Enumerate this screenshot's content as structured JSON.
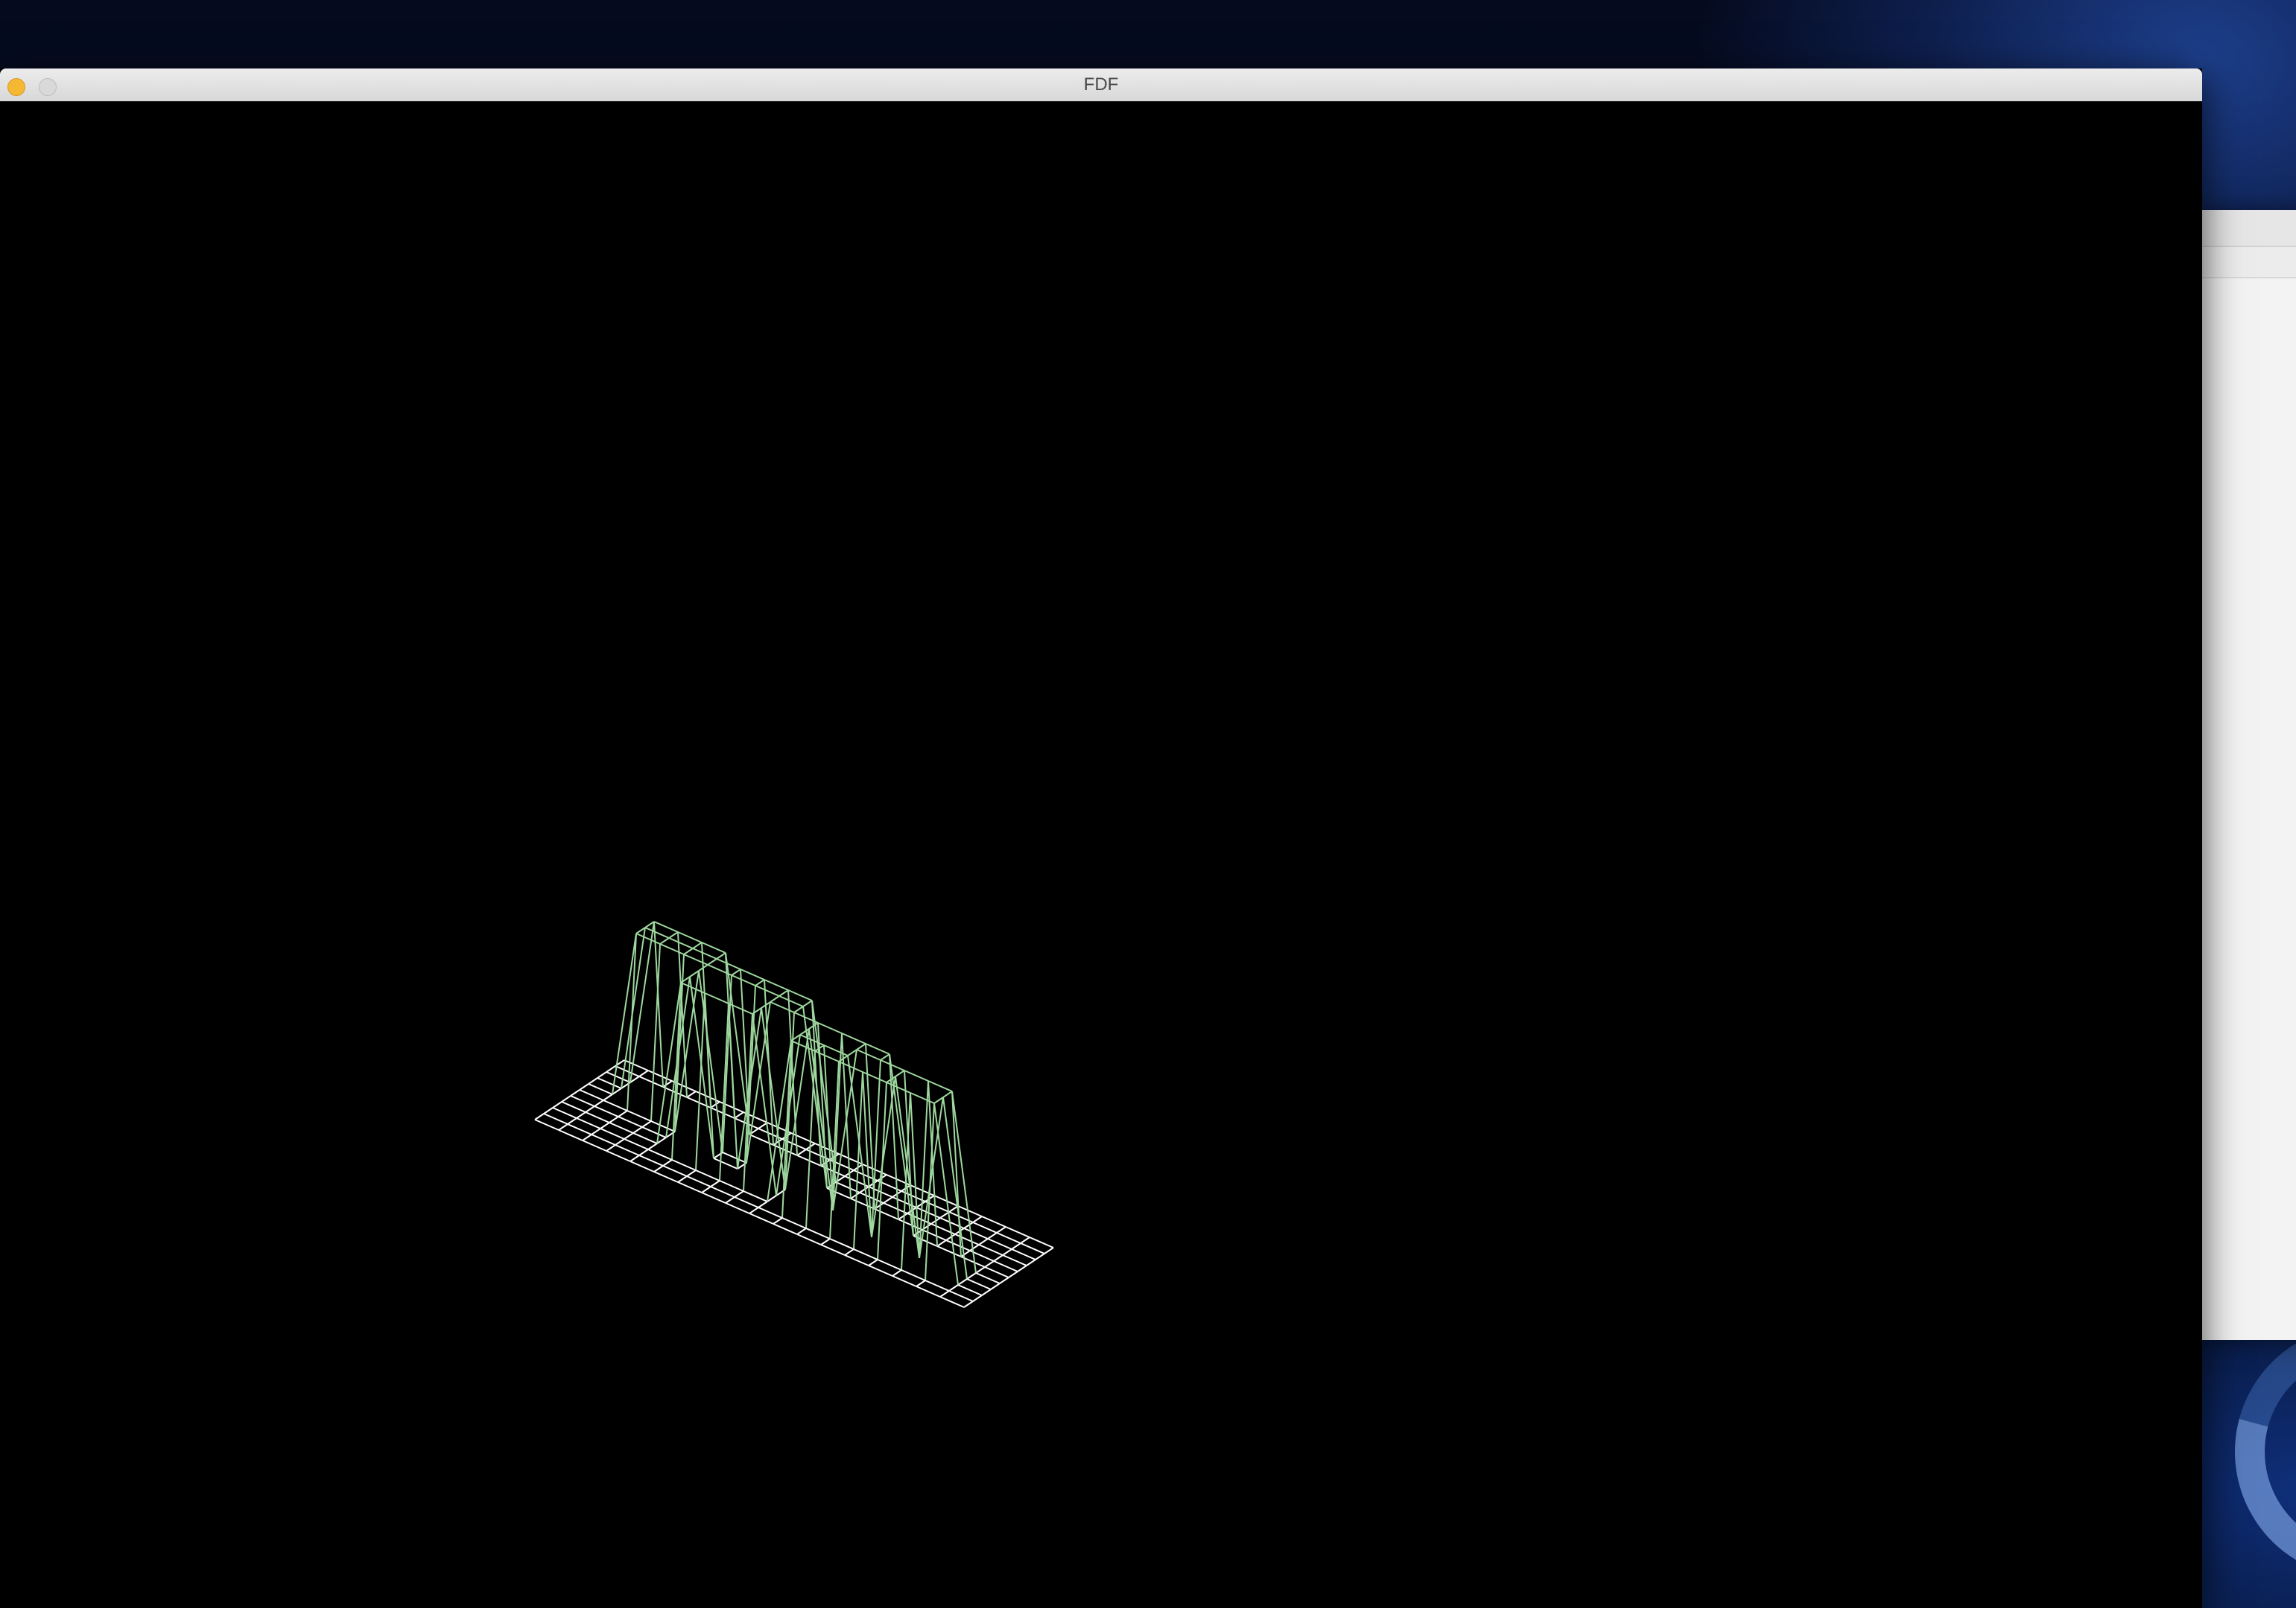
{
  "window": {
    "title": "FDF"
  },
  "colors": {
    "low_line": "#ffffff",
    "high_line": "#9fd89f",
    "canvas_bg": "#000000",
    "titlebar": "#e0e0e0",
    "close_button": "#f5b833"
  },
  "icons": {
    "close": "close-icon",
    "minimize": "minimize-icon"
  },
  "heightmap": [
    [
      0,
      0,
      0,
      0,
      0,
      0,
      0,
      0,
      0,
      0,
      0,
      0,
      0,
      0,
      0,
      0,
      0,
      0,
      0
    ],
    [
      0,
      0,
      0,
      0,
      0,
      0,
      0,
      0,
      0,
      0,
      0,
      0,
      0,
      0,
      0,
      0,
      0,
      0,
      0
    ],
    [
      0,
      0,
      10,
      10,
      10,
      10,
      0,
      0,
      0,
      0,
      0,
      0,
      0,
      0,
      0,
      0,
      0,
      0,
      0
    ],
    [
      0,
      0,
      10,
      10,
      10,
      10,
      10,
      10,
      10,
      10,
      0,
      0,
      0,
      0,
      0,
      0,
      0,
      0,
      0
    ],
    [
      0,
      0,
      10,
      10,
      10,
      10,
      10,
      10,
      10,
      10,
      0,
      0,
      0,
      0,
      0,
      0,
      0,
      0,
      0
    ],
    [
      0,
      0,
      0,
      0,
      0,
      10,
      0,
      0,
      10,
      10,
      10,
      10,
      10,
      10,
      0,
      0,
      0,
      0,
      0
    ],
    [
      0,
      0,
      0,
      0,
      0,
      10,
      0,
      0,
      10,
      0,
      10,
      0,
      10,
      10,
      10,
      10,
      10,
      0,
      0
    ],
    [
      0,
      0,
      0,
      0,
      0,
      10,
      10,
      10,
      10,
      0,
      10,
      10,
      10,
      0,
      10,
      0,
      10,
      0,
      0
    ],
    [
      0,
      0,
      0,
      0,
      0,
      0,
      0,
      0,
      0,
      0,
      10,
      10,
      10,
      10,
      10,
      10,
      10,
      0,
      0
    ],
    [
      0,
      0,
      0,
      0,
      0,
      0,
      0,
      0,
      0,
      0,
      0,
      0,
      0,
      0,
      0,
      0,
      0,
      0,
      0
    ],
    [
      0,
      0,
      0,
      0,
      0,
      0,
      0,
      0,
      0,
      0,
      0,
      0,
      0,
      0,
      0,
      0,
      0,
      0,
      0
    ]
  ]
}
